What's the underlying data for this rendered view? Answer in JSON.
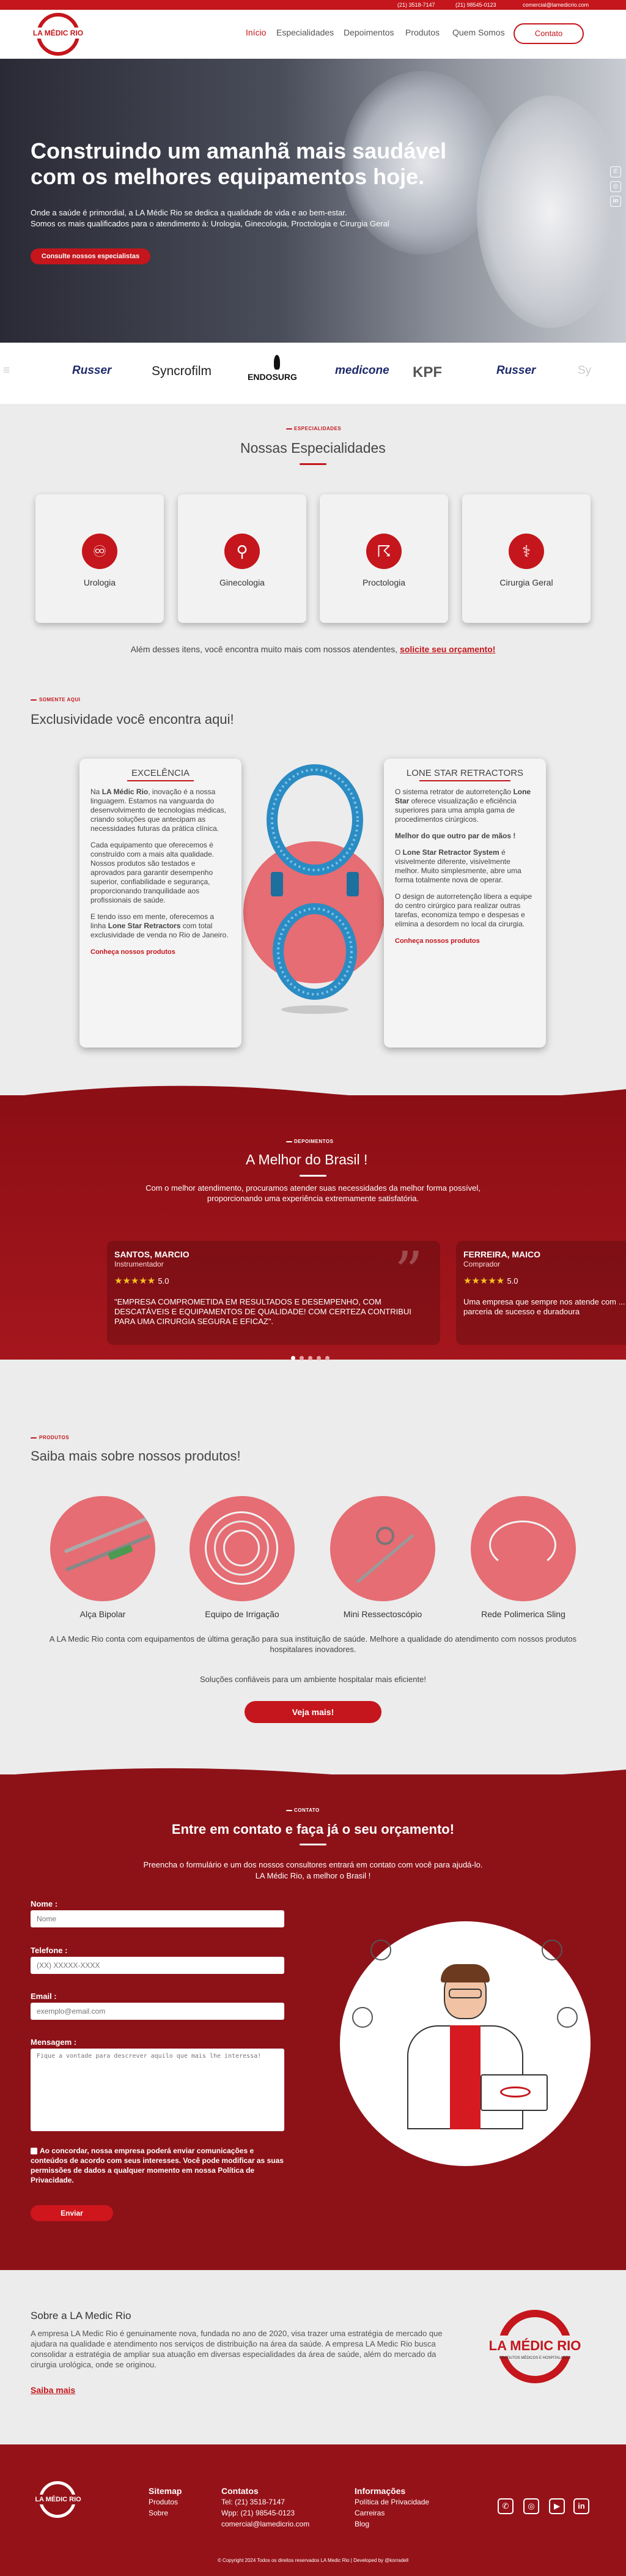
{
  "topbar": {
    "phone": "(21) 3518-7147",
    "whatsapp": "(21) 98545-0123",
    "email": "comercial@lamedicrio.com"
  },
  "brand": {
    "logo_text": "LA MÉDIC RIO",
    "logo_sub": "PRODUTOS MÉDICOS E HOSPITALARES"
  },
  "nav": {
    "items": [
      "Início",
      "Especialidades",
      "Depoimentos",
      "Produtos",
      "Quem Somos"
    ],
    "cta": "Contato"
  },
  "hero": {
    "title": "Construindo um amanhã mais saudável com os melhores equipamentos hoje.",
    "text1": "Onde a saúde é primordial, a LA Médic Rio se dedica a qualidade de vida e ao bem-estar.",
    "text2": "Somos os mais qualificados para o atendimento à: Urologia, Ginecologia, Proctologia e Cirurgia Geral",
    "button": "Consulte nossos especialistas"
  },
  "brands": [
    "Russer",
    "Syncrofilm",
    "ENDOSURG",
    "medicone",
    "KPF",
    "Russer"
  ],
  "especialidades": {
    "kicker": "ESPECIALIDADES",
    "title": "Nossas Especialidades",
    "cards": [
      {
        "label": "Urologia",
        "icon": "kidney-icon"
      },
      {
        "label": "Ginecologia",
        "icon": "uterus-icon"
      },
      {
        "label": "Proctologia",
        "icon": "intestine-icon"
      },
      {
        "label": "Cirurgia Geral",
        "icon": "scalpel-icon"
      }
    ],
    "footnote": "Além desses itens, você encontra muito mais com nossos atendentes,",
    "footnote_link": "solicite seu orçamento!"
  },
  "exclusividade": {
    "kicker": "SOMENTE AQUI",
    "title": "Exclusividade você encontra aqui!",
    "left": {
      "heading": "EXCELÊNCIA",
      "p1_a": "Na ",
      "p1_b": "LA Médic Rio",
      "p1_c": ", inovação é a nossa linguagem. Estamos na vanguarda do desenvolvimento de tecnologias médicas, criando soluções que antecipam as necessidades futuras da prática clínica.",
      "p2": "Cada equipamento que oferecemos é construído com a mais alta qualidade. Nossos produtos são testados e aprovados para garantir desempenho superior, confiabilidade e segurança, proporcionando tranquilidade aos profissionais de saúde.",
      "p3_a": "E tendo isso em mente, oferecemos a linha ",
      "p3_b": "Lone Star Retractors",
      "p3_c": " com total exclusividade de venda no Rio de Janeiro.",
      "link": "Conheça nossos produtos"
    },
    "right": {
      "heading": "LONE STAR RETRACTORS",
      "p1_a": "O sistema retrator de autorretenção ",
      "p1_b": "Lone Star",
      "p1_c": " oferece visualização e eficiência superiores para uma ampla gama de procedimentos cirúrgicos.",
      "q": "Melhor do que outro par de mãos !",
      "p2_a": "O ",
      "p2_b": "Lone Star Retractor System",
      "p2_c": " é visivelmente diferente, visivelmente melhor. Muito simplesmente, abre uma forma totalmente nova de operar.",
      "p3": "O design de autorretenção libera a equipe do centro cirúrgico para realizar outras tarefas, economiza tempo e despesas e elimina a desordem no local da cirurgia.",
      "link": "Conheça nossos produtos"
    }
  },
  "depoimentos": {
    "kicker": "DEPOIMENTOS",
    "title": "A Melhor do Brasil !",
    "subtitle": "Com o melhor atendimento, procuramos atender suas necessidades da melhor forma possível, proporcionando uma experiência extremamente satisfatória.",
    "items": [
      {
        "name": "SANTOS, MARCIO",
        "role": "Instrumentador",
        "rating": "5.0",
        "text": "\"EMPRESA COMPROMETIDA EM RESULTADOS E DESEMPENHO, COM DESCATÁVEIS E EQUIPAMENTOS DE QUALIDADE! COM CERTEZA CONTRIBUI PARA UMA CIRURGIA SEGURA E EFICAZ\"."
      },
      {
        "name": "FERREIRA, MAICO",
        "role": "Comprador",
        "rating": "5.0",
        "text": "Uma empresa que sempre nos atende com ... Temos uma parceria de sucesso e duradoura"
      }
    ]
  },
  "produtos": {
    "kicker": "PRODUTOS",
    "title": "Saiba mais sobre nossos produtos!",
    "items": [
      "Alça Bipolar",
      "Equipo de Irrigação",
      "Mini Ressectoscópio",
      "Rede Polimerica Sling"
    ],
    "text1": "A LA Medic Rio conta com equipamentos de última geração para sua instituição de saúde. Melhore a qualidade do atendimento com nossos produtos hospitalares inovadores.",
    "text2": "Soluções confiáveis para um ambiente hospitalar mais eficiente!",
    "button": "Veja mais!"
  },
  "contato": {
    "kicker": "CONTATO",
    "title": "Entre em contato e faça já o seu orçamento!",
    "subtitle1": "Preencha o formulário e um dos nossos consultores entrará em contato com você para ajudá-lo.",
    "subtitle2": "LA Médic Rio, a melhor o Brasil !",
    "name_label": "Nome :",
    "name_ph": "Nome",
    "phone_label": "Telefone :",
    "phone_ph": "(XX) XXXXX-XXXX",
    "email_label": "Email :",
    "email_ph": "exemplo@email.com",
    "msg_label": "Mensagem :",
    "msg_ph": "Fique a vontade para descrever aquilo que mais lhe interessa!",
    "consent": "Ao concordar, nossa empresa poderá enviar comunicações e conteúdos de acordo com seus interesses. Você pode modificar as suas permissões de dados a qualquer momento em nossa Política de Privacidade.",
    "submit": "Enviar"
  },
  "sobre": {
    "title": "Sobre a LA Medic Rio",
    "text": "A empresa LA Medic Rio é genuinamente nova, fundada no ano de 2020, visa trazer uma estratégia de mercado que ajudara na qualidade e atendimento nos serviços de distribuição na área da saúde. A empresa LA Medic Rio busca consolidar a estratégia de ampliar sua atuação em diversas especialidades da área de saúde, além do mercado da cirurgia urológica, onde se originou.",
    "link": "Saiba mais"
  },
  "footer": {
    "sitemap": "Sitemap",
    "sitemap_items": [
      "Produtos",
      "Sobre"
    ],
    "contatos": "Contatos",
    "contatos_items": [
      "Tel: (21) 3518-7147",
      "Wpp: (21) 98545-0123",
      "comercial@lamedicrio.com"
    ],
    "info": "Informações",
    "info_items": [
      "Política de Privacidade",
      "Carreiras",
      "Blog"
    ],
    "copyright": "© Copyright 2024 Todos os direitos reservados LA Medic Rio | Developed by @korradell"
  },
  "colors": {
    "accent": "#c4161c",
    "dark_red": "#8d1218"
  }
}
